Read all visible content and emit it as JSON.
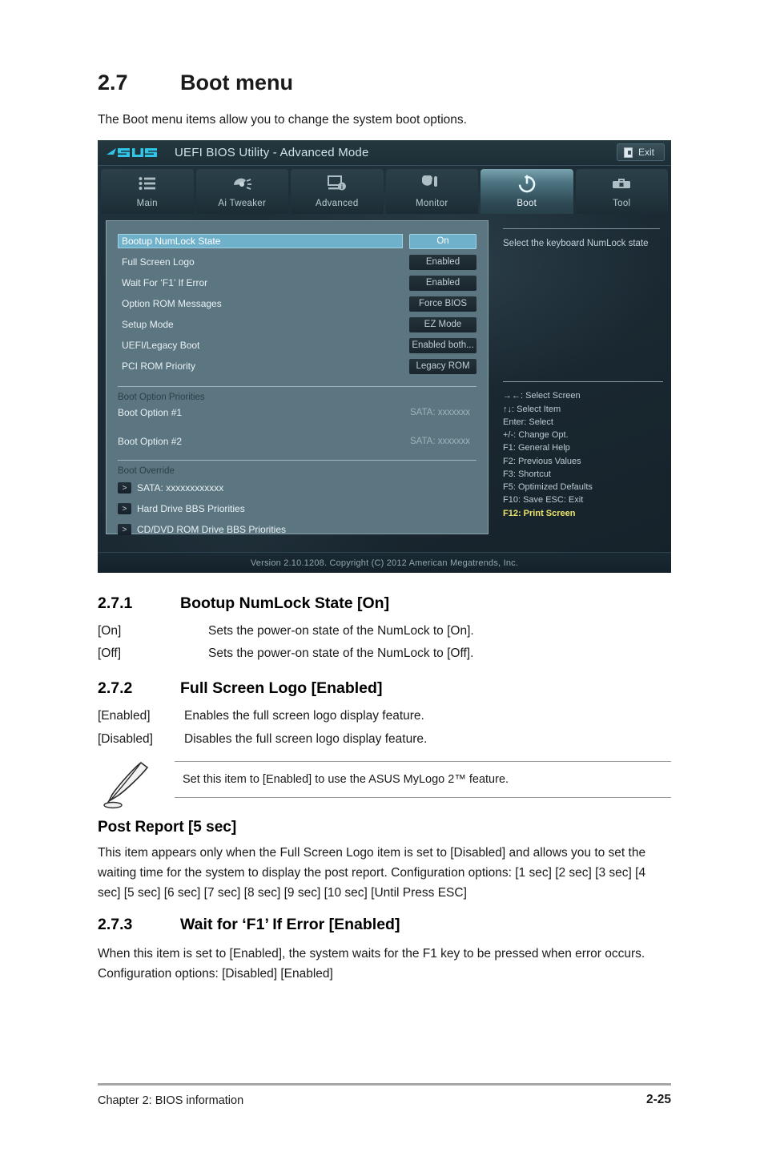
{
  "document": {
    "section_number": "2.7",
    "section_title": "Boot menu",
    "intro": "The Boot menu items allow you to change the system boot options.",
    "subsections": [
      {
        "number": "2.7.1",
        "title": "Bootup NumLock State [On]",
        "options": [
          {
            "key": "[On]",
            "desc": "Sets the power-on state of the NumLock to [On]."
          },
          {
            "key": "[Off]",
            "desc": "Sets the power-on state of the NumLock to [Off]."
          }
        ]
      },
      {
        "number": "2.7.2",
        "title": "Full Screen Logo [Enabled]",
        "options": [
          {
            "key": "[Enabled]",
            "desc": "Enables the full screen logo display feature."
          },
          {
            "key": "[Disabled]",
            "desc": "Disables the full screen logo display feature."
          }
        ]
      },
      {
        "number": "2.7.3",
        "title": "Wait for ‘F1’ If Error [Enabled]",
        "paragraph": "When this item is set to [Enabled], the system waits for the F1 key to be pressed when error occurs. Configuration options: [Disabled] [Enabled]"
      }
    ],
    "note": {
      "icon": "pencil-note-icon",
      "text": "Set this item to [Enabled] to use the ASUS MyLogo 2™ feature."
    },
    "post_report": {
      "heading": "Post Report [5 sec]",
      "paragraph": "This item appears only when the Full Screen Logo item is set to [Disabled] and allows you to set the waiting time for the system to display the post report. Configuration options: [1 sec] [2 sec] [3 sec] [4 sec] [5 sec] [6 sec] [7 sec] [8 sec] [9 sec] [10 sec] [Until Press ESC]"
    },
    "footer": {
      "left": "Chapter 2: BIOS information",
      "right": "2-25"
    }
  },
  "bios": {
    "brand": "ASUS",
    "title": "UEFI BIOS Utility - Advanced Mode",
    "exit_label": "Exit",
    "exit_icon": "exit-door-icon",
    "tabs": [
      {
        "label": "Main",
        "icon": "list-icon",
        "active": false
      },
      {
        "label": "Ai  Tweaker",
        "icon": "gauge-icon",
        "active": false
      },
      {
        "label": "Advanced",
        "icon": "monitor-info-icon",
        "active": false
      },
      {
        "label": "Monitor",
        "icon": "thermometer-icon",
        "active": false
      },
      {
        "label": "Boot",
        "icon": "power-icon",
        "active": true
      },
      {
        "label": "Tool",
        "icon": "toolbox-icon",
        "active": false
      }
    ],
    "settings": [
      {
        "label": "Bootup NumLock State",
        "value": "On",
        "selected": true
      },
      {
        "label": "Full Screen Logo",
        "value": "Enabled",
        "selected": false
      },
      {
        "label": "Wait For ‘F1’ If Error",
        "value": "Enabled",
        "selected": false
      },
      {
        "label": "Option ROM Messages",
        "value": "Force BIOS",
        "selected": false
      },
      {
        "label": "Setup Mode",
        "value": "EZ Mode",
        "selected": false
      },
      {
        "label": "UEFI/Legacy Boot",
        "value": "Enabled both...",
        "selected": false
      },
      {
        "label": "PCI ROM Priority",
        "value": "Legacy ROM",
        "selected": false
      }
    ],
    "boot_priorities": {
      "heading": "Boot Option Priorities",
      "items": [
        {
          "name": "Boot Option #1",
          "value": "SATA: xxxxxxx"
        },
        {
          "name": "Boot Option #2",
          "value": "SATA: xxxxxxx"
        }
      ]
    },
    "boot_override": {
      "heading": "Boot Override",
      "items": [
        {
          "label": "SATA: xxxxxxxxxxxx"
        },
        {
          "label": "Hard Drive BBS Priorities"
        },
        {
          "label": "CD/DVD ROM Drive BBS Priorities"
        }
      ]
    },
    "help": {
      "text": "Select the keyboard NumLock state",
      "keys": [
        {
          "text": "→←:  Select Screen",
          "highlight": false
        },
        {
          "text": "↑↓: Select Item",
          "highlight": false
        },
        {
          "text": "Enter:  Select",
          "highlight": false
        },
        {
          "text": "+/-:  Change Opt.",
          "highlight": false
        },
        {
          "text": "F1:  General Help",
          "highlight": false
        },
        {
          "text": "F2:  Previous Values",
          "highlight": false
        },
        {
          "text": "F3:  Shortcut",
          "highlight": false
        },
        {
          "text": "F5:  Optimized Defaults",
          "highlight": false
        },
        {
          "text": "F10:  Save    ESC:  Exit",
          "highlight": false
        },
        {
          "text": "F12:  Print Screen",
          "highlight": true
        }
      ]
    },
    "version": "Version  2.10.1208.   Copyright  (C)  2012  American  Megatrends,  Inc.",
    "colors": {
      "accent_highlight": "#6fb1cb",
      "panel": "#5b7681",
      "logo": "#27c2e8",
      "key_highlight": "#ece36a"
    }
  }
}
